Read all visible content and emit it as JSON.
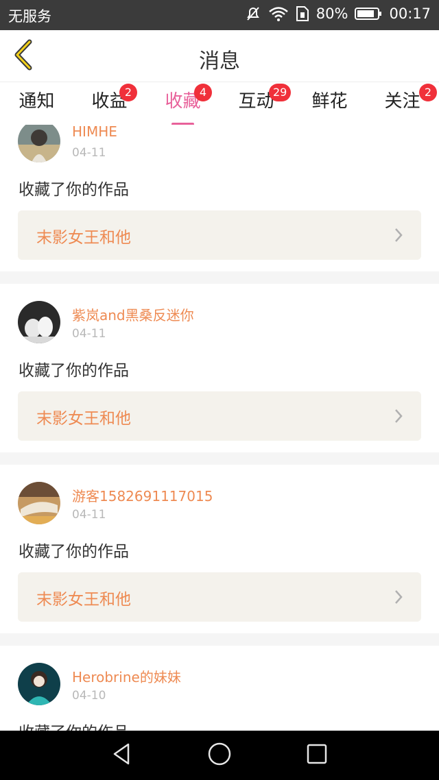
{
  "status_bar": {
    "carrier": "无服务",
    "battery_percent": "80%",
    "time": "00:17",
    "icons": [
      "mute-icon",
      "wifi-icon",
      "sim-icon",
      "battery-icon"
    ]
  },
  "header": {
    "title": "消息",
    "back_icon": "chevron-left-icon"
  },
  "tabs": [
    {
      "label": "通知",
      "badge": ""
    },
    {
      "label": "收益",
      "badge": "2"
    },
    {
      "label": "收藏",
      "badge": "4",
      "active": true
    },
    {
      "label": "互动",
      "badge": "29"
    },
    {
      "label": "鲜花",
      "badge": ""
    },
    {
      "label": "关注",
      "badge": "2"
    }
  ],
  "colors": {
    "accent_pink": "#e8619a",
    "username_orange": "#ee8a52",
    "badge_red": "#f0303a",
    "work_box_bg": "#f4f2ec"
  },
  "items": [
    {
      "username": "HIMHE",
      "date": "04-11",
      "action": "收藏了你的作品",
      "work_title": "末影女王和他"
    },
    {
      "username": "紫岚and黑桑反迷你",
      "date": "04-11",
      "action": "收藏了你的作品",
      "work_title": "末影女王和他"
    },
    {
      "username": "游客1582691117015",
      "date": "04-11",
      "action": "收藏了你的作品",
      "work_title": "末影女王和他"
    },
    {
      "username": "Herobrine的妹妹",
      "date": "04-10",
      "action": "收藏了你的作品",
      "work_title": ""
    }
  ],
  "nav_bar": {
    "icons": [
      "back-triangle-icon",
      "home-circle-icon",
      "recents-square-icon"
    ]
  }
}
